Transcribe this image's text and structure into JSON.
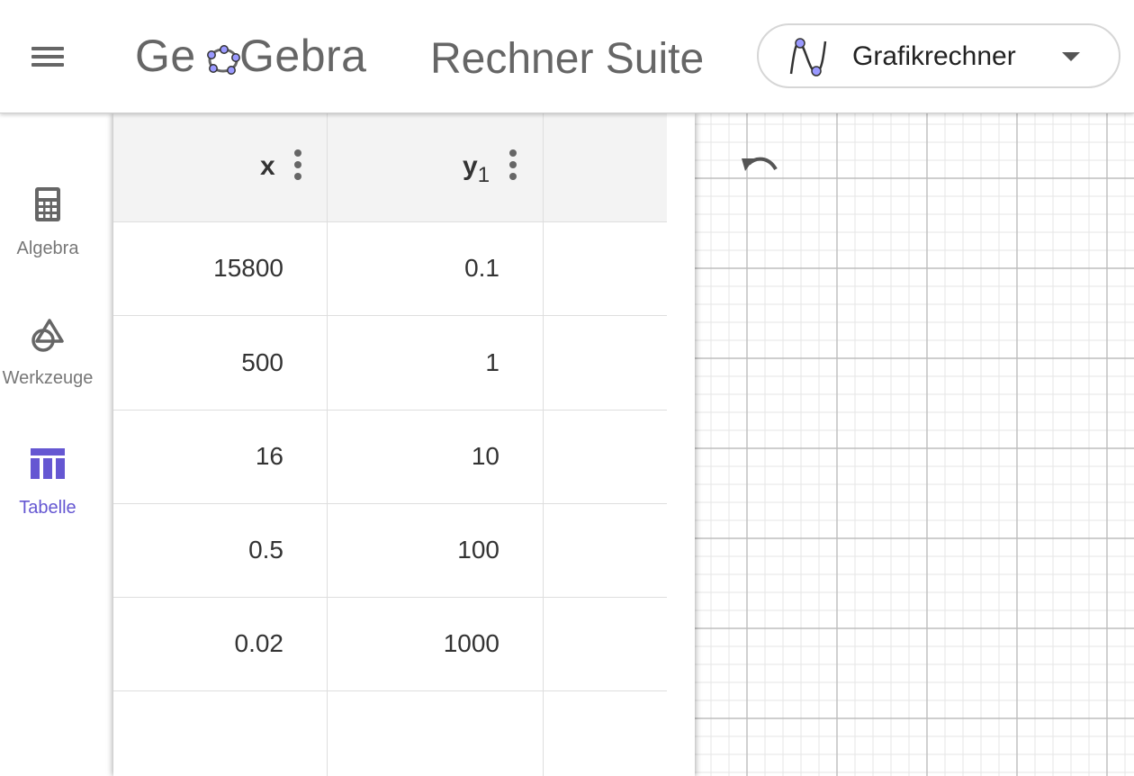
{
  "header": {
    "menu_icon": "hamburger-menu-icon",
    "logo_text_left": "Ge",
    "logo_text_right": "Gebra",
    "title": "Rechner Suite",
    "app_switcher": {
      "label": "Grafikrechner",
      "icon": "graphing-function-icon",
      "caret_icon": "caret-down-icon"
    }
  },
  "nav": {
    "items": [
      {
        "label": "Algebra",
        "icon": "calculator-icon",
        "active": false
      },
      {
        "label": "Werkzeuge",
        "icon": "shapes-tools-icon",
        "active": false
      },
      {
        "label": "Tabelle",
        "icon": "table-icon",
        "active": true
      }
    ]
  },
  "table": {
    "columns": [
      {
        "label": "x",
        "subscript": ""
      },
      {
        "label": "y",
        "subscript": "1"
      }
    ],
    "rows": [
      {
        "x": "15800",
        "y1": "0.1"
      },
      {
        "x": "500",
        "y1": "1"
      },
      {
        "x": "16",
        "y1": "10"
      },
      {
        "x": "0.5",
        "y1": "100"
      },
      {
        "x": "0.02",
        "y1": "1000"
      },
      {
        "x": "",
        "y1": ""
      }
    ]
  },
  "graphics": {
    "undo_icon": "undo-icon",
    "grid": true,
    "grid_major_color": "#bdbdbd",
    "grid_minor_color": "#e6e6e6"
  },
  "colors": {
    "accent": "#6557d2",
    "text": "#333333",
    "muted": "#666666",
    "header_row_bg": "#f3f3f3"
  }
}
